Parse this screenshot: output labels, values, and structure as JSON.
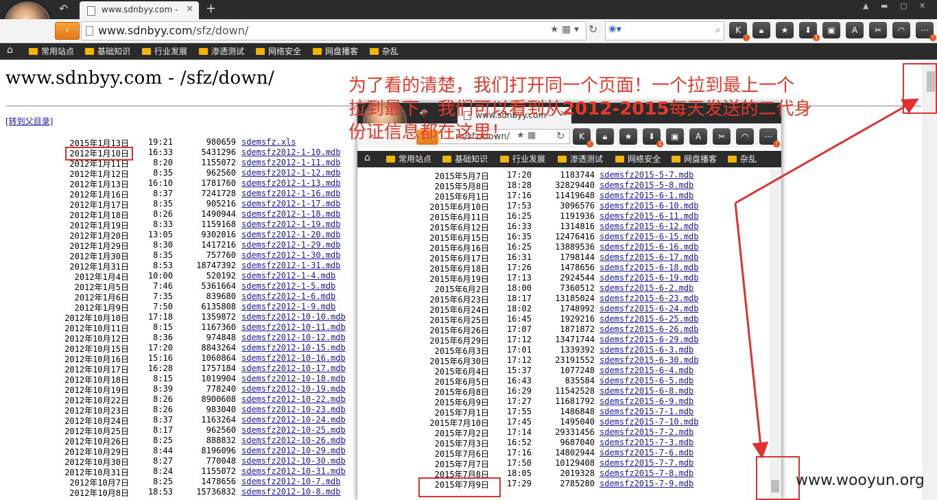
{
  "browser": {
    "tab_title": "www.sdnbyy.com -",
    "url_domain": "www.sdnbyy.com",
    "url_path": "/sfz/down/",
    "bookmarks": [
      "常用站点",
      "基础知识",
      "行业发展",
      "渗透测试",
      "网络安全",
      "网盘播客",
      "杂乱"
    ]
  },
  "page": {
    "heading": "www.sdnbyy.com - /sfz/down/",
    "parent_link": "[转到父目录]",
    "files": [
      {
        "date": "2015年1月13日",
        "time": "19:21",
        "size": "980659",
        "name": "sdemsfz.xls"
      },
      {
        "date": "2012年1月10日",
        "time": "16:33",
        "size": "5431296",
        "name": "sdemsfz2012-1-10.mdb"
      },
      {
        "date": "2012年1月11日",
        "time": "8:20",
        "size": "1155072",
        "name": "sdemsfz2012-1-11.mdb"
      },
      {
        "date": "2012年1月12日",
        "time": "8:35",
        "size": "962560",
        "name": "sdemsfz2012-1-12.mdb"
      },
      {
        "date": "2012年1月13日",
        "time": "16:10",
        "size": "1781760",
        "name": "sdemsfz2012-1-13.mdb"
      },
      {
        "date": "2012年1月16日",
        "time": "8:37",
        "size": "7241728",
        "name": "sdemsfz2012-1-16.mdb"
      },
      {
        "date": "2012年1月17日",
        "time": "8:35",
        "size": "905216",
        "name": "sdemsfz2012-1-17.mdb"
      },
      {
        "date": "2012年1月18日",
        "time": "8:26",
        "size": "1490944",
        "name": "sdemsfz2012-1-18.mdb"
      },
      {
        "date": "2012年1月19日",
        "time": "8:33",
        "size": "1159168",
        "name": "sdemsfz2012-1-19.mdb"
      },
      {
        "date": "2012年1月20日",
        "time": "13:05",
        "size": "9302016",
        "name": "sdemsfz2012-1-20.mdb"
      },
      {
        "date": "2012年1月29日",
        "time": "8:30",
        "size": "1417216",
        "name": "sdemsfz2012-1-29.mdb"
      },
      {
        "date": "2012年1月30日",
        "time": "8:35",
        "size": "757760",
        "name": "sdemsfz2012-1-30.mdb"
      },
      {
        "date": "2012年1月31日",
        "time": "8:53",
        "size": "18747392",
        "name": "sdemsfz2012-1-31.mdb"
      },
      {
        "date": "2012年1月4日",
        "time": "10:00",
        "size": "520192",
        "name": "sdemsfz2012-1-4.mdb"
      },
      {
        "date": "2012年1月5日",
        "time": "7:46",
        "size": "5361664",
        "name": "sdemsfz2012-1-5.mdb"
      },
      {
        "date": "2012年1月6日",
        "time": "7:35",
        "size": "839680",
        "name": "sdemsfz2012-1-6.mdb"
      },
      {
        "date": "2012年1月9日",
        "time": "7:50",
        "size": "6135808",
        "name": "sdemsfz2012-1-9.mdb"
      },
      {
        "date": "2012年10月10日",
        "time": "17:18",
        "size": "1359872",
        "name": "sdemsfz2012-10-10.mdb"
      },
      {
        "date": "2012年10月11日",
        "time": "8:15",
        "size": "1167360",
        "name": "sdemsfz2012-10-11.mdb"
      },
      {
        "date": "2012年10月12日",
        "time": "8:36",
        "size": "974848",
        "name": "sdemsfz2012-10-12.mdb"
      },
      {
        "date": "2012年10月15日",
        "time": "17:20",
        "size": "8843264",
        "name": "sdemsfz2012-10-15.mdb"
      },
      {
        "date": "2012年10月16日",
        "time": "15:16",
        "size": "1060864",
        "name": "sdemsfz2012-10-16.mdb"
      },
      {
        "date": "2012年10月17日",
        "time": "16:28",
        "size": "1757184",
        "name": "sdemsfz2012-10-17.mdb"
      },
      {
        "date": "2012年10月18日",
        "time": "8:15",
        "size": "1019904",
        "name": "sdemsfz2012-10-18.mdb"
      },
      {
        "date": "2012年10月19日",
        "time": "8:39",
        "size": "778240",
        "name": "sdemsfz2012-10-19.mdb"
      },
      {
        "date": "2012年10月22日",
        "time": "8:26",
        "size": "8900608",
        "name": "sdemsfz2012-10-22.mdb"
      },
      {
        "date": "2012年10月23日",
        "time": "8:26",
        "size": "983040",
        "name": "sdemsfz2012-10-23.mdb"
      },
      {
        "date": "2012年10月24日",
        "time": "8:37",
        "size": "1163264",
        "name": "sdemsfz2012-10-24.mdb"
      },
      {
        "date": "2012年10月25日",
        "time": "8:17",
        "size": "962560",
        "name": "sdemsfz2012-10-25.mdb"
      },
      {
        "date": "2012年10月26日",
        "time": "8:25",
        "size": "888832",
        "name": "sdemsfz2012-10-26.mdb"
      },
      {
        "date": "2012年10月29日",
        "time": "8:44",
        "size": "8196096",
        "name": "sdemsfz2012-10-29.mdb"
      },
      {
        "date": "2012年10月30日",
        "time": "8:27",
        "size": "770048",
        "name": "sdemsfz2012-10-30.mdb"
      },
      {
        "date": "2012年10月31日",
        "time": "8:24",
        "size": "1155072",
        "name": "sdemsfz2012-10-31.mdb"
      },
      {
        "date": "2012年10月7日",
        "time": "8:25",
        "size": "1478656",
        "name": "sdemsfz2012-10-7.mdb"
      },
      {
        "date": "2012年10月8日",
        "time": "18:53",
        "size": "15736832",
        "name": "sdemsfz2012-10-8.mdb"
      }
    ]
  },
  "annotation": {
    "line1": "为了看的清楚，我们打开同一个页面！一个拉到最上一个",
    "line2a": "拉到最下，我们可以看到从",
    "line2b": "2012-2015",
    "line2c": "每天发送的二代身",
    "line3": "份证信息都在这里！"
  },
  "overlay": {
    "tab_title": "www.sdnbyy.com -",
    "url_text": "m/sfz/down/",
    "files": [
      {
        "date": "2015年5月7日",
        "time": "17:20",
        "size": "1183744",
        "name": "sdemsfz2015-5-7.mdb"
      },
      {
        "date": "2015年5月8日",
        "time": "18:28",
        "size": "32829440",
        "name": "sdemsfz2015-5-8.mdb"
      },
      {
        "date": "2015年6月1日",
        "time": "17:16",
        "size": "11419648",
        "name": "sdemsfz2015-6-1.mdb"
      },
      {
        "date": "2015年6月10日",
        "time": "17:53",
        "size": "3096576",
        "name": "sdemsfz2015-6-10.mdb"
      },
      {
        "date": "2015年6月11日",
        "time": "16:25",
        "size": "1191936",
        "name": "sdemsfz2015-6-11.mdb"
      },
      {
        "date": "2015年6月12日",
        "time": "16:33",
        "size": "1314816",
        "name": "sdemsfz2015-6-12.mdb"
      },
      {
        "date": "2015年6月15日",
        "time": "16:35",
        "size": "12476416",
        "name": "sdemsfz2015-6-15.mdb"
      },
      {
        "date": "2015年6月16日",
        "time": "16:25",
        "size": "13889536",
        "name": "sdemsfz2015-6-16.mdb"
      },
      {
        "date": "2015年6月17日",
        "time": "16:31",
        "size": "1798144",
        "name": "sdemsfz2015-6-17.mdb"
      },
      {
        "date": "2015年6月18日",
        "time": "17:26",
        "size": "1478656",
        "name": "sdemsfz2015-6-18.mdb"
      },
      {
        "date": "2015年6月19日",
        "time": "17:13",
        "size": "2924544",
        "name": "sdemsfz2015-6-19.mdb"
      },
      {
        "date": "2015年6月2日",
        "time": "18:00",
        "size": "7360512",
        "name": "sdemsfz2015-6-2.mdb"
      },
      {
        "date": "2015年6月23日",
        "time": "18:17",
        "size": "13185024",
        "name": "sdemsfz2015-6-23.mdb"
      },
      {
        "date": "2015年6月24日",
        "time": "18:02",
        "size": "1748992",
        "name": "sdemsfz2015-6-24.mdb"
      },
      {
        "date": "2015年6月25日",
        "time": "16:45",
        "size": "1929216",
        "name": "sdemsfz2015-6-25.mdb"
      },
      {
        "date": "2015年6月26日",
        "time": "17:07",
        "size": "1871872",
        "name": "sdemsfz2015-6-26.mdb"
      },
      {
        "date": "2015年6月29日",
        "time": "17:12",
        "size": "13471744",
        "name": "sdemsfz2015-6-29.mdb"
      },
      {
        "date": "2015年6月3日",
        "time": "17:01",
        "size": "1339392",
        "name": "sdemsfz2015-6-3.mdb"
      },
      {
        "date": "2015年6月30日",
        "time": "17:12",
        "size": "23191552",
        "name": "sdemsfz2015-6-30.mdb"
      },
      {
        "date": "2015年6月4日",
        "time": "15:37",
        "size": "1077248",
        "name": "sdemsfz2015-6-4.mdb"
      },
      {
        "date": "2015年6月5日",
        "time": "16:43",
        "size": "835584",
        "name": "sdemsfz2015-6-5.mdb"
      },
      {
        "date": "2015年6月8日",
        "time": "16:29",
        "size": "11542528",
        "name": "sdemsfz2015-6-8.mdb"
      },
      {
        "date": "2015年6月9日",
        "time": "17:27",
        "size": "11681792",
        "name": "sdemsfz2015-6-9.mdb"
      },
      {
        "date": "2015年7月1日",
        "time": "17:55",
        "size": "1486848",
        "name": "sdemsfz2015-7-1.mdb"
      },
      {
        "date": "2015年7月10日",
        "time": "17:45",
        "size": "1495040",
        "name": "sdemsfz2015-7-10.mdb"
      },
      {
        "date": "2015年7月2日",
        "time": "17:14",
        "size": "29331456",
        "name": "sdemsfz2015-7-2.mdb"
      },
      {
        "date": "2015年7月3日",
        "time": "16:52",
        "size": "9687040",
        "name": "sdemsfz2015-7-3.mdb"
      },
      {
        "date": "2015年7月6日",
        "time": "17:16",
        "size": "14802944",
        "name": "sdemsfz2015-7-6.mdb"
      },
      {
        "date": "2015年7月7日",
        "time": "17:50",
        "size": "10129408",
        "name": "sdemsfz2015-7-7.mdb"
      },
      {
        "date": "2015年7月8日",
        "time": "18:05",
        "size": "2019328",
        "name": "sdemsfz2015-7-8.mdb"
      },
      {
        "date": "2015年7月9日",
        "time": "17:29",
        "size": "2785280",
        "name": "sdemsfz2015-7-9.mdb"
      }
    ]
  },
  "watermark": "www.wooyun.org"
}
